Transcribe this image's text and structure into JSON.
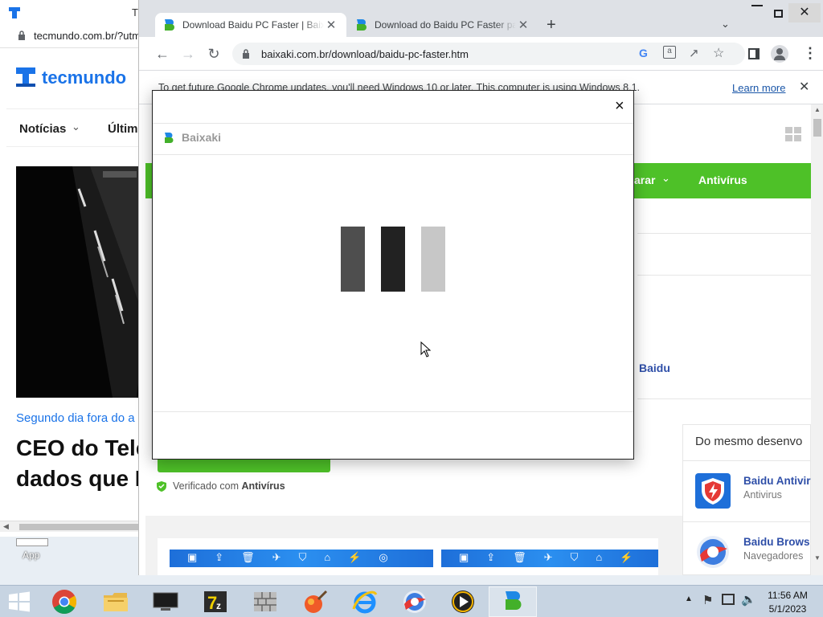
{
  "back_window": {
    "url": "tecmundo.com.br/?utm",
    "brand_first": "tec",
    "brand_second": "mundo",
    "nav_item_1": "Notícias",
    "nav_item_2": "Últim",
    "headline_kicker": "Segundo dia fora do a",
    "headline_line_1": "CEO do Tele",
    "headline_line_2": "dados que H"
  },
  "desktop": {
    "app_label": "App"
  },
  "chrome": {
    "tabs": [
      {
        "title": "Download Baidu PC Faster | Baixaki",
        "active": true
      },
      {
        "title": "Download do Baidu PC Faster para",
        "active": false
      }
    ],
    "new_tab": "+",
    "url": "baixaki.com.br/download/baidu-pc-faster.htm",
    "infobar_text": "To get future Google Chrome updates, you'll need Windows 10 or later. This computer is using Windows 8.1.",
    "infobar_link": "Learn more"
  },
  "page": {
    "nav_partial": "arar",
    "nav_antivirus": "Antivírus",
    "baidu_partial": "Baidu",
    "verified_prefix": "Verificado com",
    "verified_bold": "Antivírus",
    "sidebar_title": "Do mesmo desenvo",
    "related": [
      {
        "name": "Baidu Antivir",
        "category": "Antivirus"
      },
      {
        "name": "Baidu Brows",
        "category": "Navegadores"
      }
    ]
  },
  "modal": {
    "close": "×",
    "brand": "Baixaki"
  },
  "taskbar": {
    "time": "11:56 AM",
    "date": "5/1/2023"
  },
  "colors": {
    "baixaki_green": "#4ec128",
    "tecmundo_blue": "#1a73e8",
    "link_blue": "#1a56a8"
  }
}
